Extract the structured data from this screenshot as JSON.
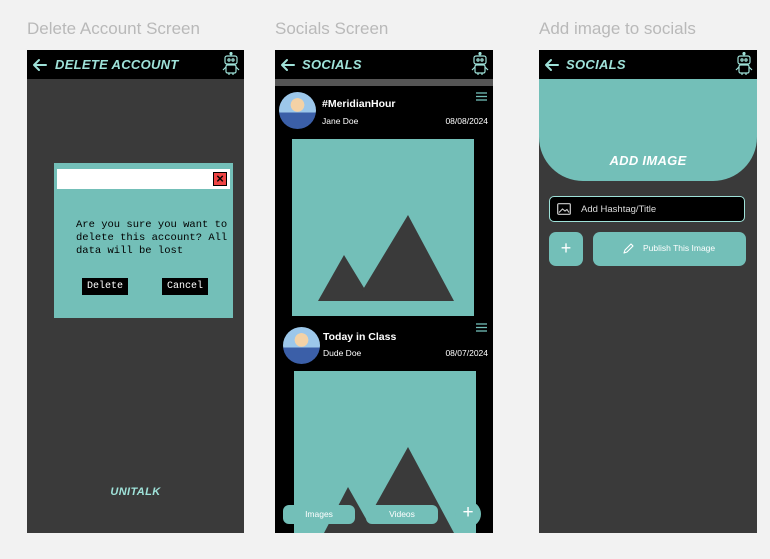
{
  "frames": [
    {
      "title": "Delete Account Screen",
      "topbar_title": "DELETE ACCOUNT",
      "dialog": {
        "message": "Are you sure you want to delete this account? All data will be lost",
        "delete_label": "Delete",
        "cancel_label": "Cancel"
      },
      "brand": "UNITALK"
    },
    {
      "title": "Socials Screen",
      "topbar_title": "SOCIALS",
      "posts": [
        {
          "title": "#MeridianHour",
          "user": "Jane Doe",
          "date": "08/08/2024"
        },
        {
          "title": "Today in Class",
          "user": "Dude Doe",
          "date": "08/07/2024"
        }
      ],
      "tabs": [
        "Images",
        "Videos"
      ],
      "fab_label": "+"
    },
    {
      "title": "Add image to socials",
      "topbar_title": "SOCIALS",
      "add_image_label": "ADD IMAGE",
      "hashtag_placeholder": "Add Hashtag/Title",
      "plus_label": "+",
      "publish_label": "Publish This Image"
    }
  ],
  "colors": {
    "accent": "#73bfb8",
    "title_text": "#9fe2d9",
    "screen_bg": "#3a3a3a",
    "bar_bg": "#000000",
    "close_red": "#ee4444"
  }
}
